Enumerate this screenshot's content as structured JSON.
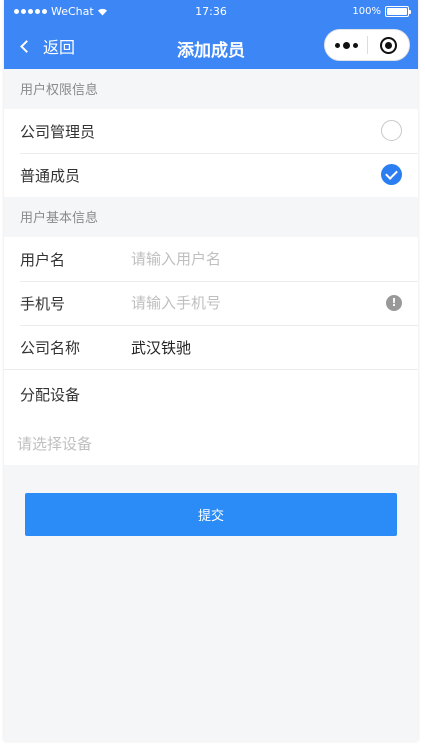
{
  "status_bar": {
    "carrier": "WeChat",
    "time": "17:36",
    "battery": "100%"
  },
  "nav": {
    "back_label": "返回",
    "title": "添加成员"
  },
  "permission_section": {
    "title": "用户权限信息",
    "options": [
      {
        "label": "公司管理员",
        "checked": false
      },
      {
        "label": "普通成员",
        "checked": true
      }
    ]
  },
  "basic_section": {
    "title": "用户基本信息",
    "username": {
      "label": "用户名",
      "placeholder": "请输入用户名",
      "value": ""
    },
    "phone": {
      "label": "手机号",
      "placeholder": "请输入手机号",
      "value": ""
    },
    "company": {
      "label": "公司名称",
      "value": "武汉铁驰"
    },
    "device": {
      "label": "分配设备",
      "placeholder": "请选择设备"
    }
  },
  "submit_label": "提交",
  "colors": {
    "brand": "#3d86f5",
    "check": "#2b7ef1",
    "button": "#2b8cf7"
  }
}
